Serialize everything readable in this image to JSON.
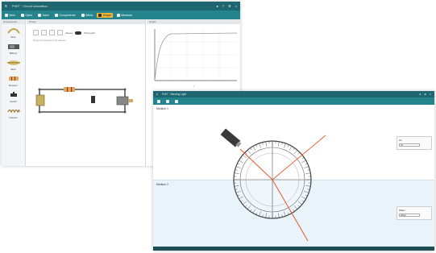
{
  "window_a": {
    "title": "PhET · Circuit simulation",
    "toolbar": [
      {
        "label": "New",
        "active": false
      },
      {
        "label": "Open",
        "active": false
      },
      {
        "label": "Save",
        "active": false
      },
      {
        "label": "Components",
        "active": false
      },
      {
        "label": "Wires",
        "active": false
      },
      {
        "label": "Graph",
        "active": true
      },
      {
        "label": "Measure",
        "active": false
      }
    ],
    "sidebar": {
      "header": "Components",
      "items": [
        {
          "label": "Wire",
          "icon": "wire-icon"
        },
        {
          "label": "Battery",
          "icon": "battery-icon"
        },
        {
          "label": "Bulb",
          "icon": "bulb-icon"
        },
        {
          "label": "Resistor",
          "icon": "resistor-icon"
        },
        {
          "label": "Switch",
          "icon": "switch-icon"
        },
        {
          "label": "Inductor",
          "icon": "inductor-icon"
        }
      ]
    },
    "canvas": {
      "header": "Circuit",
      "toggle_left": "Values",
      "toggle_right": "Schematic",
      "hint": "Drag components onto canvas"
    },
    "graph": {
      "header": "Graph",
      "xlabel": "t"
    }
  },
  "window_b": {
    "title": "PhET · Bending Light",
    "medium_1_label": "Medium 1",
    "medium_2_label": "Medium 2",
    "panel_1": {
      "label": "Air",
      "value": "Air"
    },
    "panel_2": {
      "label": "Water",
      "value": "Water"
    },
    "colors": {
      "bar": "#1f6770",
      "laser": "#e8572a",
      "medium2": "#e8f3fa"
    }
  }
}
